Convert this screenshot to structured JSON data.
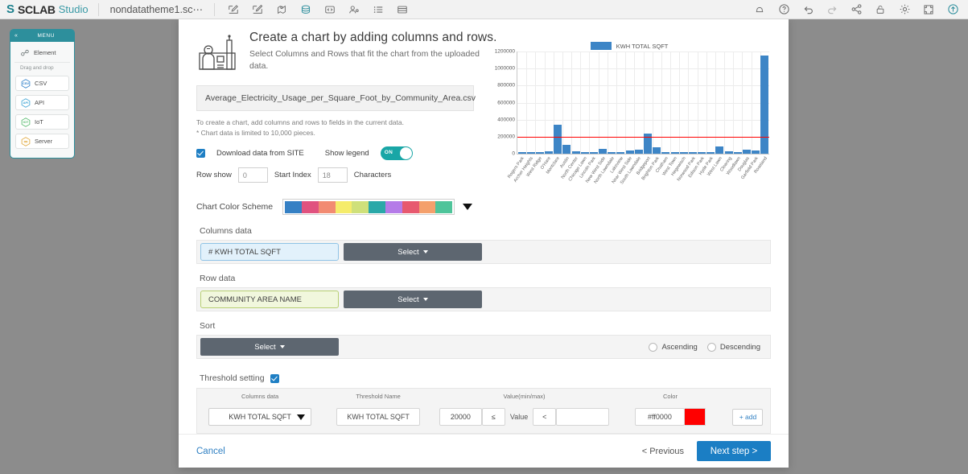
{
  "topbar": {
    "brand_mark": "S",
    "brand_name": "SCLAB",
    "brand_suffix": "Studio",
    "document_tab": "nondatatheme1.sc⋯",
    "left_tools": [
      {
        "name": "edit-draw-icon"
      },
      {
        "name": "edit-draw-alt-icon"
      },
      {
        "name": "map-pin-icon"
      },
      {
        "name": "database-icon"
      },
      {
        "name": "code-icon"
      },
      {
        "name": "user-settings-icon"
      },
      {
        "name": "list-icon"
      },
      {
        "name": "table-icon"
      }
    ],
    "right_tools": [
      {
        "name": "bell-icon"
      },
      {
        "name": "help-icon"
      },
      {
        "name": "undo-icon"
      },
      {
        "name": "redo-icon"
      },
      {
        "name": "share-icon"
      },
      {
        "name": "lock-icon"
      },
      {
        "name": "gear-icon"
      },
      {
        "name": "fullscreen-icon"
      },
      {
        "name": "publish-icon"
      }
    ]
  },
  "sidebar": {
    "header": "MENU",
    "collapse_glyph": "«",
    "element_label": "Element",
    "drag_label": "Drag and drop",
    "items": [
      {
        "label": "CSV",
        "icon": "csv-hex-icon",
        "color": "#2f7fc8"
      },
      {
        "label": "API",
        "icon": "api-hex-icon",
        "color": "#3ba3d4"
      },
      {
        "label": "IoT",
        "icon": "iot-hex-icon",
        "color": "#53b96b"
      },
      {
        "label": "Server",
        "icon": "server-hex-icon",
        "color": "#e0a73a"
      }
    ]
  },
  "dialog": {
    "icon": "chart-builder-illustration",
    "title": "Create a chart by adding columns and rows.",
    "subtitle": "Select Columns and Rows that fit the chart from the uploaded data.",
    "file_name": "Average_Electricity_Usage_per_Square_Foot_by_Community_Area.csv",
    "note_line1": "To create a chart, add columns and rows to fields in the current data.",
    "note_line2": "* Chart data is limited to 10,000 pieces.",
    "download_checkbox_label": "Download data from SITE",
    "download_checked": true,
    "show_legend_label": "Show legend",
    "toggle_state": "ON",
    "row_show_label": "Row show",
    "row_show_value": "0",
    "start_index_label": "Start Index",
    "start_index_value": "18",
    "characters_label": "Characters",
    "color_scheme_label": "Chart Color Scheme",
    "color_scheme_swatches": [
      "#3580c4",
      "#e0527f",
      "#f28b72",
      "#f5ec6b",
      "#cfe07a",
      "#2aa8a8",
      "#b57be8",
      "#e7596f",
      "#f4a06c",
      "#4ec49a"
    ],
    "columns_data_label": "Columns data",
    "columns_token": "# KWH TOTAL SQFT",
    "columns_select_label": "Select",
    "row_data_label": "Row data",
    "row_token": "COMMUNITY AREA NAME",
    "row_select_label": "Select",
    "sort_label": "Sort",
    "sort_select_label": "Select",
    "ascending_label": "Ascending",
    "descending_label": "Descending",
    "threshold_label": "Threshold setting",
    "threshold_checked": true,
    "threshold_headers": [
      "Columns data",
      "Threshold Name",
      "Value(min/max)",
      "Color"
    ],
    "threshold_row": {
      "column": "KWH TOTAL SQFT",
      "name": "KWH TOTAL SQFT",
      "min_value": "20000",
      "min_operator": "≤",
      "value_word": "Value",
      "max_operator": "<",
      "max_value": "",
      "color_hex": "#ff0000",
      "color_hex_text": "#ff0000",
      "add_label": "+ add"
    },
    "cancel_label": "Cancel",
    "previous_label": "< Previous",
    "next_label": "Next step >"
  },
  "chart_data": {
    "type": "bar",
    "title": "",
    "legend": [
      "KWH TOTAL SQFT"
    ],
    "legend_position": "top-center",
    "series_color": "#3d85c6",
    "xlabel": "",
    "ylabel": "",
    "ylim": [
      0,
      1200000
    ],
    "yticks": [
      0,
      200000,
      400000,
      600000,
      800000,
      1000000,
      1200000
    ],
    "ytick_labels": [
      "0",
      "200000",
      "400000",
      "600000",
      "800000",
      "1000000",
      "1200000"
    ],
    "grid": true,
    "threshold_line": {
      "value": 200000,
      "color": "#ff0000"
    },
    "categories": [
      "Rogers Park",
      "Archer Heights",
      "West Ridge",
      "O'Hare",
      "Montclare",
      "Austin",
      "North Center",
      "Chicago Lawn",
      "Lincoln Park",
      "New West Side",
      "North Lawndale",
      "Lakeview",
      "Near West Side",
      "South Lawndale",
      "Bridgeport",
      "Brighton Park",
      "Chatham",
      "West Town",
      "Hegewisch",
      "Norwood Park",
      "Edison Park",
      "Hyde Park",
      "West Lawn",
      "Clearing",
      "Woodlawn",
      "Douglas",
      "Garfield Park",
      "Roseland"
    ],
    "values": [
      20000,
      18000,
      22000,
      26000,
      345000,
      105000,
      24000,
      21000,
      18000,
      55000,
      20000,
      18000,
      35000,
      45000,
      240000,
      80000,
      22000,
      20000,
      18000,
      20000,
      19000,
      18000,
      85000,
      25000,
      22000,
      45000,
      35000,
      1150000
    ],
    "max_value": 1150000,
    "max_category": "Roseland"
  }
}
